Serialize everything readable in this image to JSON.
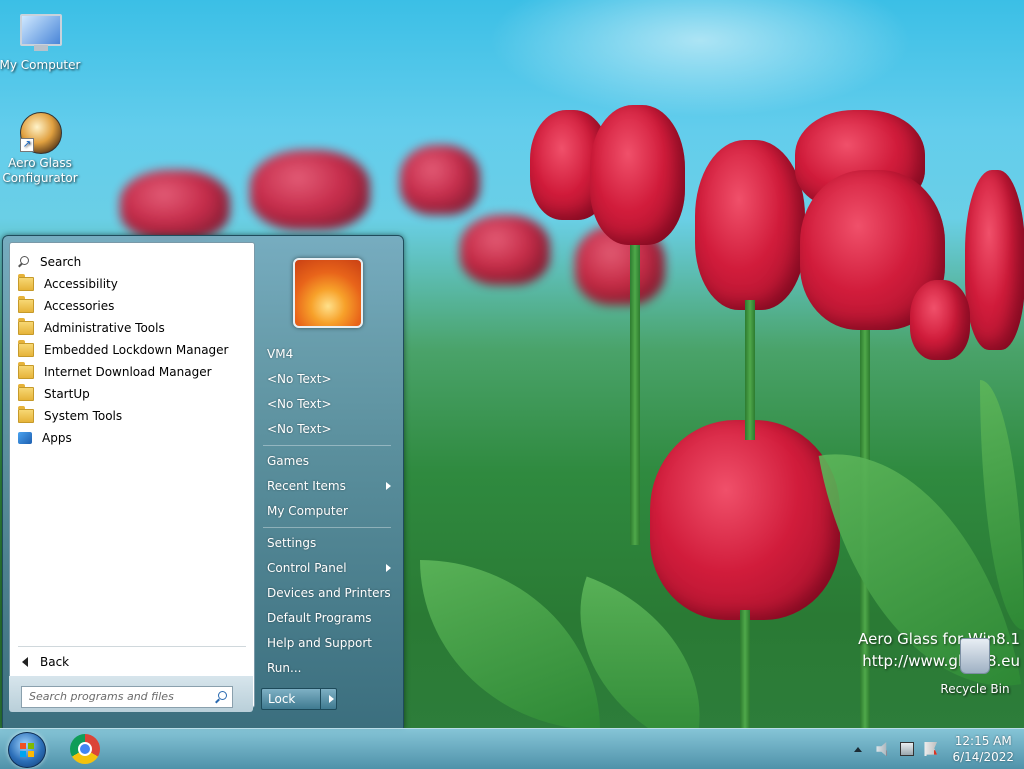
{
  "desktop": {
    "icons": [
      {
        "label": "My Computer",
        "icon": "my-computer-icon"
      },
      {
        "label": "Aero Glass Configurator",
        "icon": "aero-glass-icon"
      },
      {
        "label": "Recycle Bin",
        "icon": "recycle-bin-icon"
      }
    ],
    "watermark": {
      "line1": "Aero Glass for Win8.1",
      "line2": "http://www.glass8.eu"
    }
  },
  "start_menu": {
    "programs": [
      {
        "label": "Search",
        "icon": "search-icon"
      },
      {
        "label": "Accessibility",
        "icon": "folder-icon"
      },
      {
        "label": "Accessories",
        "icon": "folder-icon"
      },
      {
        "label": "Administrative Tools",
        "icon": "folder-icon"
      },
      {
        "label": "Embedded Lockdown Manager",
        "icon": "folder-icon"
      },
      {
        "label": "Internet Download Manager",
        "icon": "folder-icon"
      },
      {
        "label": "StartUp",
        "icon": "folder-icon"
      },
      {
        "label": "System Tools",
        "icon": "folder-icon"
      },
      {
        "label": "Apps",
        "icon": "apps-icon"
      }
    ],
    "back_label": "Back",
    "search_placeholder": "Search programs and files",
    "right_items": [
      {
        "label": "VM4",
        "submenu": false
      },
      {
        "label": "<No Text>",
        "submenu": false
      },
      {
        "label": "<No Text>",
        "submenu": false
      },
      {
        "label": "<No Text>",
        "submenu": false
      },
      {
        "label": "Games",
        "submenu": false
      },
      {
        "label": "Recent Items",
        "submenu": true
      },
      {
        "label": "My Computer",
        "submenu": false
      },
      {
        "label": "Settings",
        "submenu": false
      },
      {
        "label": "Control Panel",
        "submenu": true
      },
      {
        "label": "Devices and Printers",
        "submenu": false
      },
      {
        "label": "Default Programs",
        "submenu": false
      },
      {
        "label": "Help and Support",
        "submenu": false
      },
      {
        "label": "Run...",
        "submenu": false
      }
    ],
    "lock_label": "Lock"
  },
  "taskbar": {
    "pinned": [
      "start-orb",
      "chrome-icon"
    ],
    "clock": {
      "time": "12:15 AM",
      "date": "6/14/2022"
    },
    "tray_icons": [
      "show-hidden-icons",
      "speaker-muted-icon",
      "network-icon",
      "action-center-icon"
    ]
  }
}
